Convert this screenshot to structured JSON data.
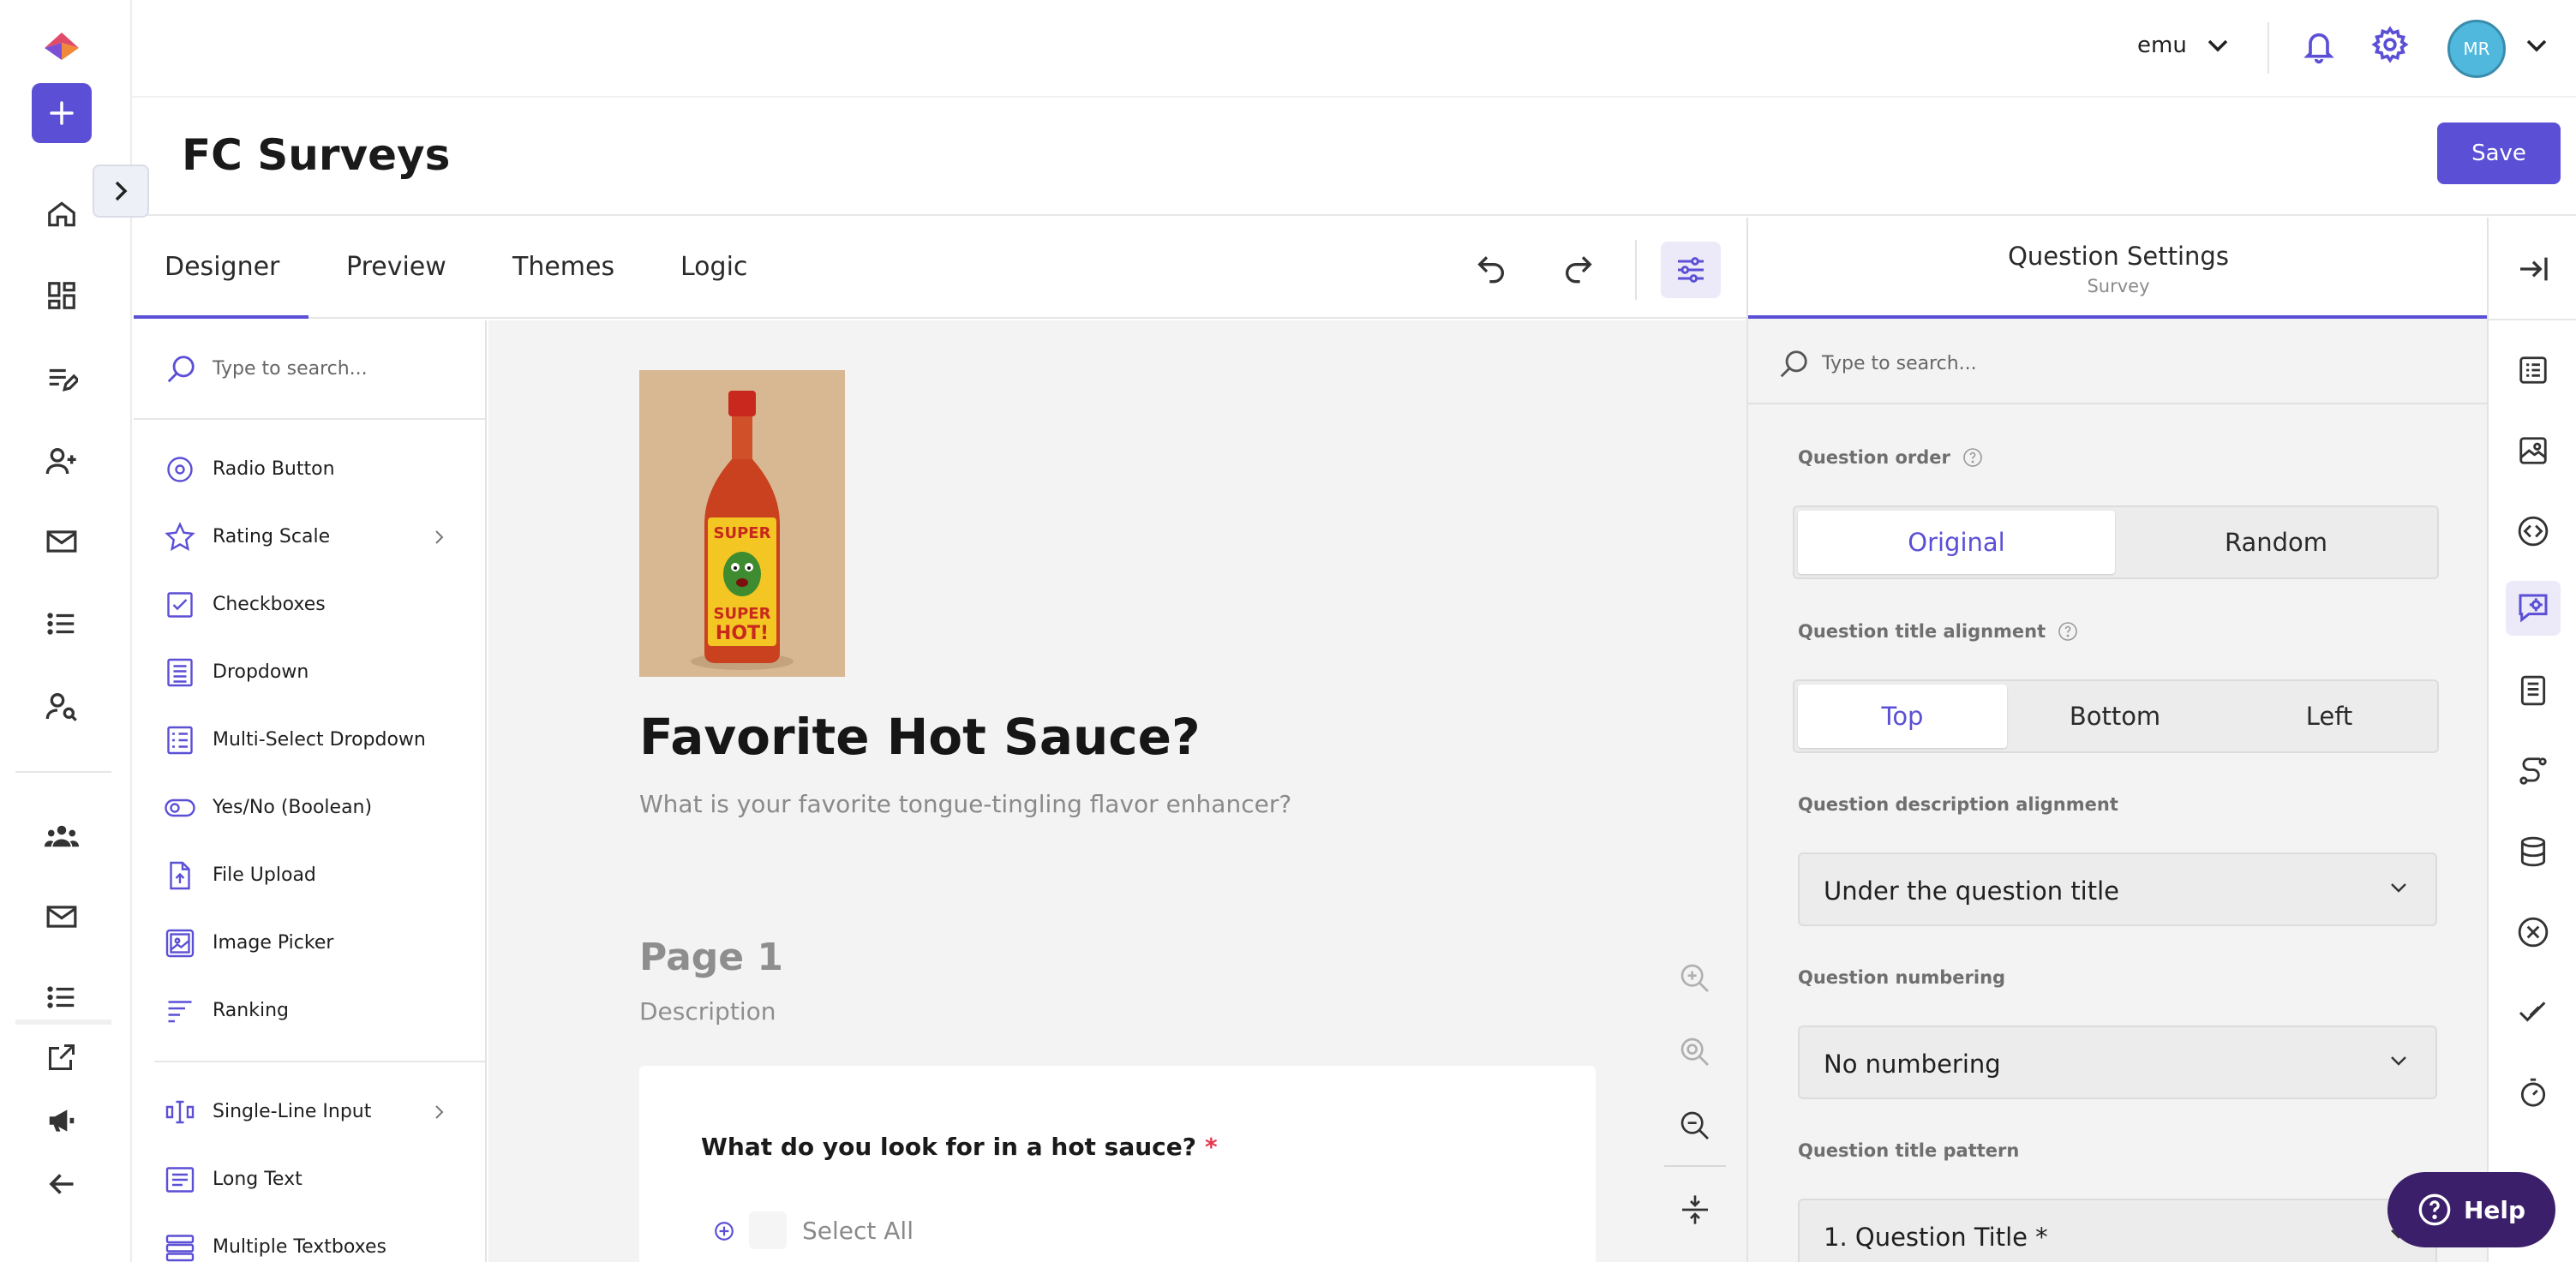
{
  "colors": {
    "accent": "#5b4fd6",
    "help_bg": "#3b1f6b",
    "avatar_bg": "#4fb8dc",
    "required": "#e5364d"
  },
  "header": {
    "tenant": "emu",
    "avatar_initials": "MR",
    "page_title": "FC Surveys",
    "save_label": "Save"
  },
  "tabs": [
    {
      "label": "Designer",
      "active": true
    },
    {
      "label": "Preview"
    },
    {
      "label": "Themes"
    },
    {
      "label": "Logic"
    }
  ],
  "toolbox": {
    "search_placeholder": "Type to search...",
    "items": [
      {
        "label": "Radio Button",
        "icon": "radio-icon"
      },
      {
        "label": "Rating Scale",
        "icon": "star-icon",
        "has_submenu": true
      },
      {
        "label": "Checkboxes",
        "icon": "checkbox-icon"
      },
      {
        "label": "Dropdown",
        "icon": "dropdown-icon"
      },
      {
        "label": "Multi-Select Dropdown",
        "icon": "multi-dropdown-icon"
      },
      {
        "label": "Yes/No (Boolean)",
        "icon": "toggle-icon"
      },
      {
        "label": "File Upload",
        "icon": "upload-icon"
      },
      {
        "label": "Image Picker",
        "icon": "image-icon"
      },
      {
        "label": "Ranking",
        "icon": "ranking-icon"
      },
      {
        "label": "Single-Line Input",
        "icon": "text-input-icon",
        "has_submenu": true
      },
      {
        "label": "Long Text",
        "icon": "long-text-icon"
      },
      {
        "label": "Multiple Textboxes",
        "icon": "multi-text-icon"
      }
    ]
  },
  "survey": {
    "title": "Favorite Hot Sauce?",
    "description": "What is your favorite tongue-tingling flavor enhancer?",
    "image_label": {
      "line1": "SUPER",
      "line2": "SUPER",
      "line3": "HOT!"
    },
    "page": {
      "name": "Page 1",
      "description": "Description"
    },
    "question": {
      "title": "What do you look for in a hot sauce?",
      "required_mark": "*",
      "select_all": "Select All"
    }
  },
  "panel": {
    "title": "Question Settings",
    "subtitle": "Survey",
    "search_placeholder": "Type to search...",
    "question_order": {
      "label": "Question order",
      "options": [
        "Original",
        "Random"
      ],
      "selected": "Original"
    },
    "title_alignment": {
      "label": "Question title alignment",
      "options": [
        "Top",
        "Bottom",
        "Left"
      ],
      "selected": "Top"
    },
    "description_alignment": {
      "label": "Question description alignment",
      "value": "Under the question title"
    },
    "numbering": {
      "label": "Question numbering",
      "value": "No numbering"
    },
    "title_pattern": {
      "label": "Question title pattern",
      "value": "1. Question Title *"
    }
  },
  "help": {
    "label": "Help"
  }
}
